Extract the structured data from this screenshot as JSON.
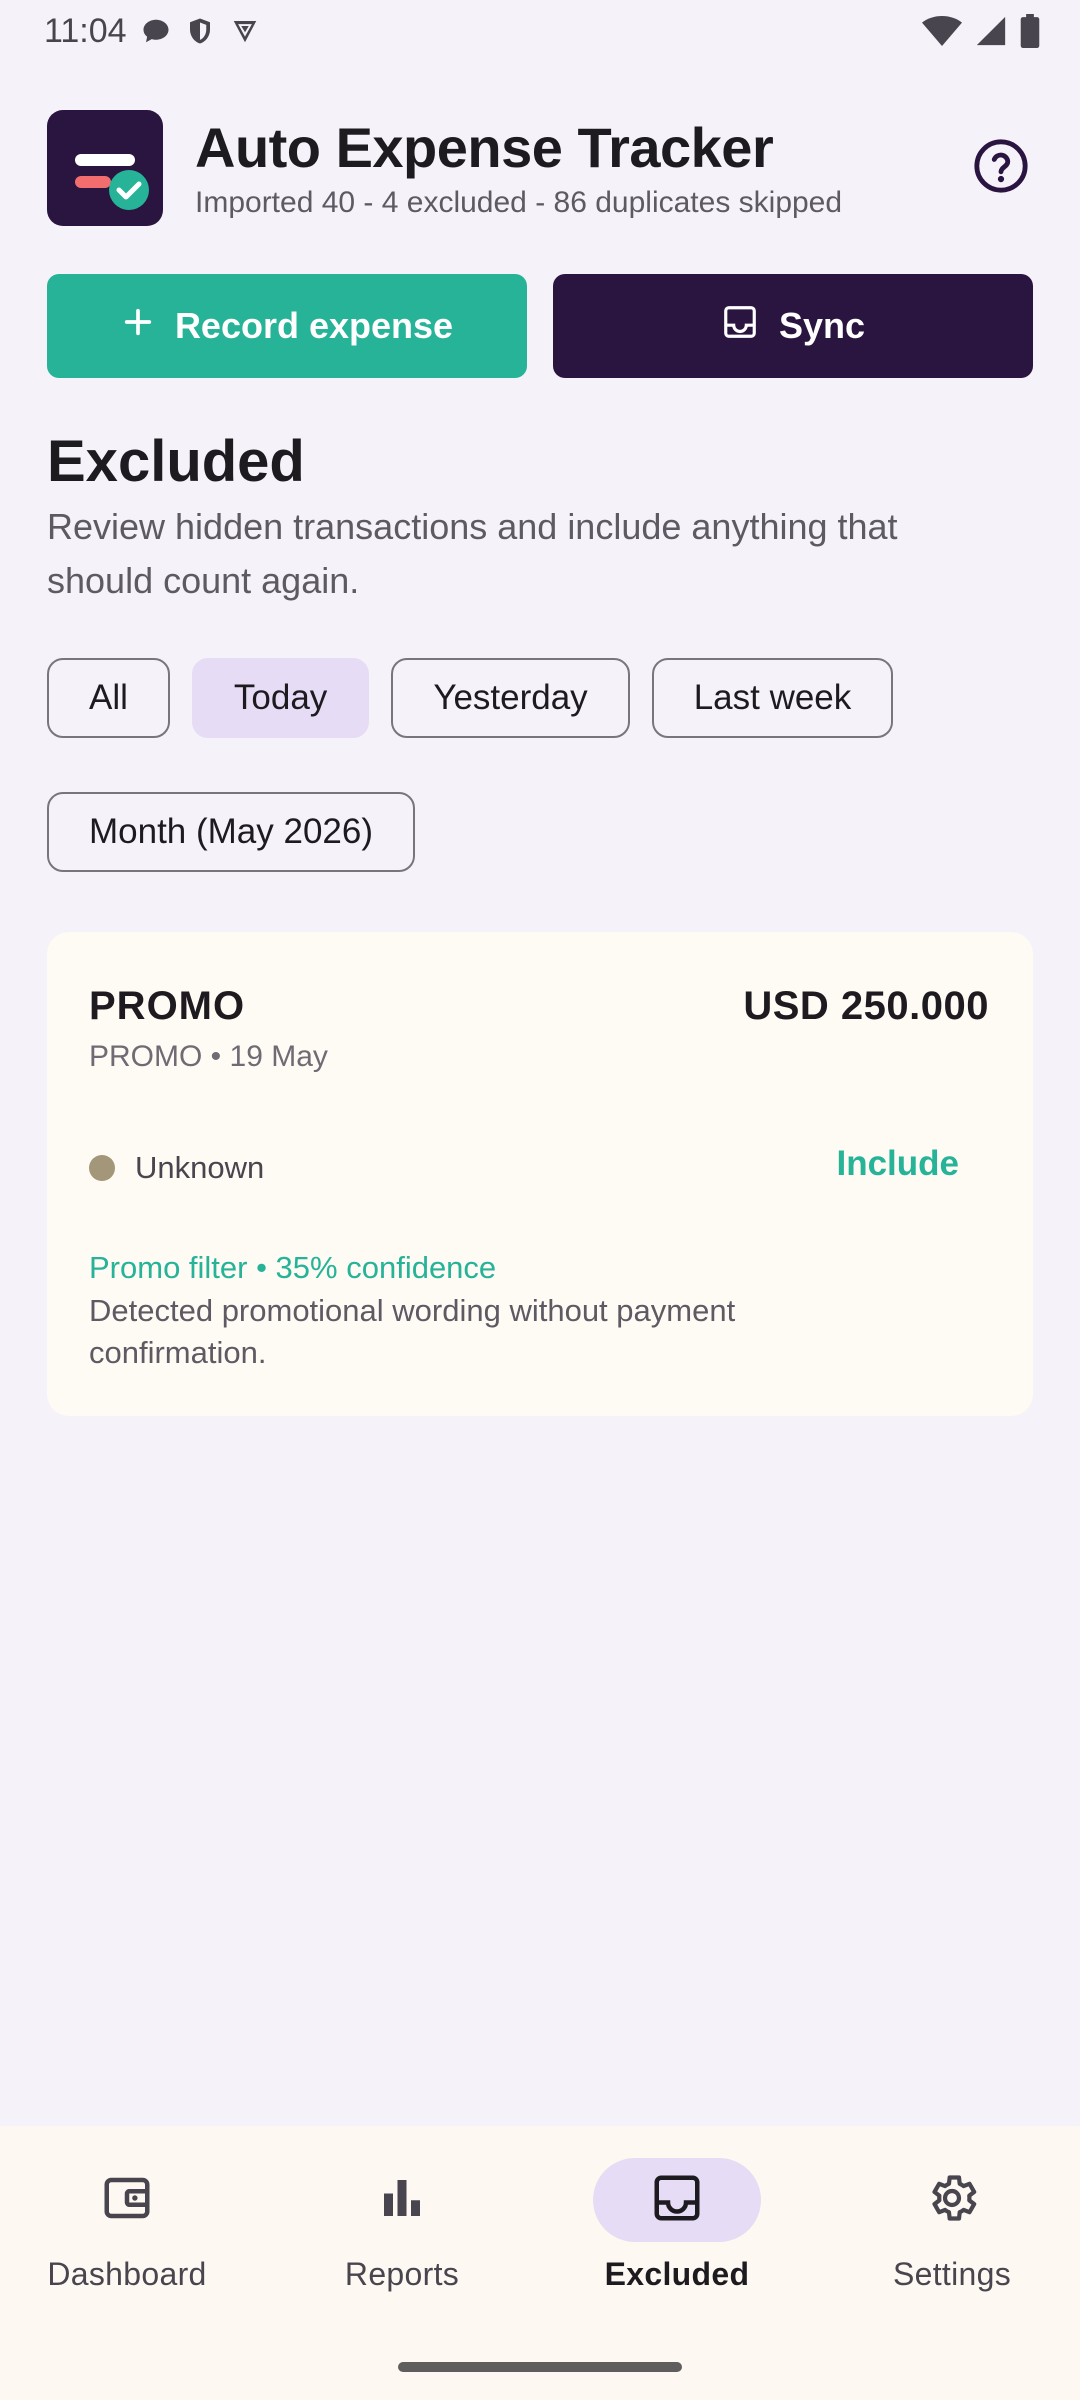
{
  "status_bar": {
    "time": "11:04",
    "left_icons": [
      "chat-bubble-icon",
      "shield-icon",
      "vpn-icon"
    ],
    "right_icons": [
      "wifi-icon",
      "signal-icon",
      "battery-icon"
    ]
  },
  "header": {
    "title": "Auto Expense Tracker",
    "subtitle": "Imported 40 - 4 excluded - 86 duplicates skipped",
    "logo_icon": "app-logo-icon",
    "help_icon": "help-circle-icon"
  },
  "actions": {
    "record_label": "Record expense",
    "sync_label": "Sync"
  },
  "section": {
    "title": "Excluded",
    "description": "Review hidden transactions and include anything that should count again."
  },
  "filters": {
    "chips": [
      "All",
      "Today",
      "Yesterday",
      "Last week",
      "Month (May 2026)"
    ],
    "selected": "Today"
  },
  "transaction": {
    "merchant": "PROMO",
    "amount": "USD 250.000",
    "meta": "PROMO • 19 May",
    "category": "Unknown",
    "include_label": "Include",
    "filter_line": "Promo filter • 35% confidence",
    "reason": "Detected promotional wording without payment confirmation."
  },
  "bottom_nav": {
    "items": [
      {
        "label": "Dashboard",
        "icon": "wallet-icon"
      },
      {
        "label": "Reports",
        "icon": "bar-chart-icon"
      },
      {
        "label": "Excluded",
        "icon": "inbox-icon"
      },
      {
        "label": "Settings",
        "icon": "gear-icon"
      }
    ],
    "active": "Excluded"
  },
  "colors": {
    "accent": "#26b398",
    "primary_dark": "#2a1440",
    "chip_selected": "#e6dcf5",
    "background": "#f6f2f9",
    "card": "#fefaf4"
  }
}
